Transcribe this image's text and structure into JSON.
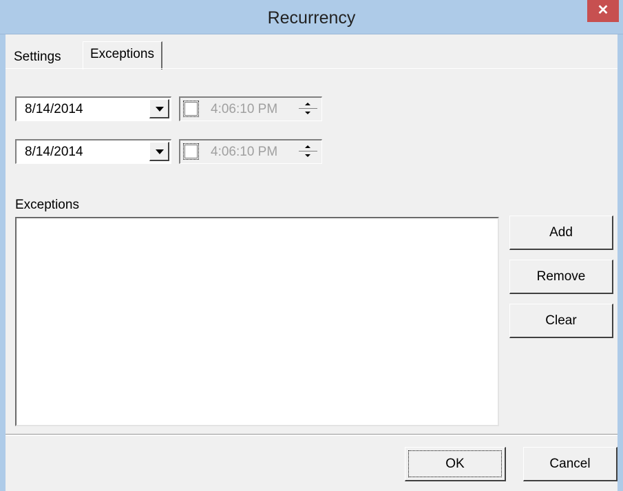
{
  "window": {
    "title": "Recurrency",
    "close_glyph": "✕"
  },
  "tabs": [
    {
      "label": "Settings",
      "active": false
    },
    {
      "label": "Exceptions",
      "active": true
    }
  ],
  "range": {
    "start": {
      "date": "8/14/2014",
      "time": "4:06:10 PM",
      "time_enabled": false
    },
    "end": {
      "date": "8/14/2014",
      "time": "4:06:10 PM",
      "time_enabled": false
    }
  },
  "exceptions": {
    "label": "Exceptions",
    "items": [],
    "buttons": {
      "add": "Add",
      "remove": "Remove",
      "clear": "Clear"
    }
  },
  "footer": {
    "ok": "OK",
    "cancel": "Cancel"
  },
  "colors": {
    "titlebar": "#aecbe8",
    "close": "#c75050",
    "face": "#f0f0f0"
  }
}
